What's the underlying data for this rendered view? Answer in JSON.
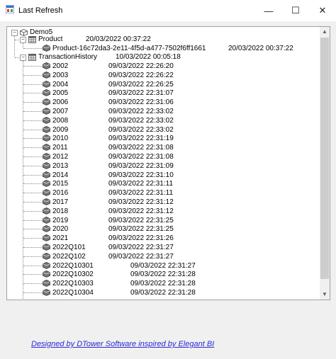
{
  "window": {
    "title": "Last Refresh",
    "minimize": "—",
    "maximize": "☐",
    "close": "✕"
  },
  "tree": {
    "root": {
      "label": "Demo5"
    },
    "product": {
      "label": "Product",
      "timestamp": "20/03/2022 00:37:22",
      "child": {
        "label": "Product-16c72da3-2e11-4f5d-a477-7502f6ff1661",
        "timestamp": "20/03/2022 00:37:22"
      }
    },
    "transaction_history": {
      "label": "TransactionHistory",
      "timestamp": "10/03/2022 00:05:18",
      "partitions": [
        {
          "label": "2002",
          "timestamp": "09/03/2022 22:26:20"
        },
        {
          "label": "2003",
          "timestamp": "09/03/2022 22:26:22"
        },
        {
          "label": "2004",
          "timestamp": "09/03/2022 22:26:25"
        },
        {
          "label": "2005",
          "timestamp": "09/03/2022 22:31:07"
        },
        {
          "label": "2006",
          "timestamp": "09/03/2022 22:31:06"
        },
        {
          "label": "2007",
          "timestamp": "09/03/2022 22:33:02"
        },
        {
          "label": "2008",
          "timestamp": "09/03/2022 22:33:02"
        },
        {
          "label": "2009",
          "timestamp": "09/03/2022 22:33:02"
        },
        {
          "label": "2010",
          "timestamp": "09/03/2022 22:31:19"
        },
        {
          "label": "2011",
          "timestamp": "09/03/2022 22:31:08"
        },
        {
          "label": "2012",
          "timestamp": "09/03/2022 22:31:08"
        },
        {
          "label": "2013",
          "timestamp": "09/03/2022 22:31:09"
        },
        {
          "label": "2014",
          "timestamp": "09/03/2022 22:31:10"
        },
        {
          "label": "2015",
          "timestamp": "09/03/2022 22:31:11"
        },
        {
          "label": "2016",
          "timestamp": "09/03/2022 22:31:11"
        },
        {
          "label": "2017",
          "timestamp": "09/03/2022 22:31:12"
        },
        {
          "label": "2018",
          "timestamp": "09/03/2022 22:31:12"
        },
        {
          "label": "2019",
          "timestamp": "09/03/2022 22:31:25"
        },
        {
          "label": "2020",
          "timestamp": "09/03/2022 22:31:25"
        },
        {
          "label": "2021",
          "timestamp": "09/03/2022 22:31:26"
        },
        {
          "label": "2022Q101",
          "timestamp": "09/03/2022 22:31:27"
        },
        {
          "label": "2022Q102",
          "timestamp": "09/03/2022 22:31:27"
        },
        {
          "label": "2022Q10301",
          "timestamp": "09/03/2022 22:31:27"
        },
        {
          "label": "2022Q10302",
          "timestamp": "09/03/2022 22:31:28"
        },
        {
          "label": "2022Q10303",
          "timestamp": "09/03/2022 22:31:28"
        },
        {
          "label": "2022Q10304",
          "timestamp": "09/03/2022 22:31:28"
        }
      ]
    }
  },
  "footer": {
    "link_text": "Designed by DTower Software inspired by Elegant BI"
  },
  "icons": {
    "database": "database-icon",
    "table": "table-icon",
    "partition": "partition-icon"
  }
}
